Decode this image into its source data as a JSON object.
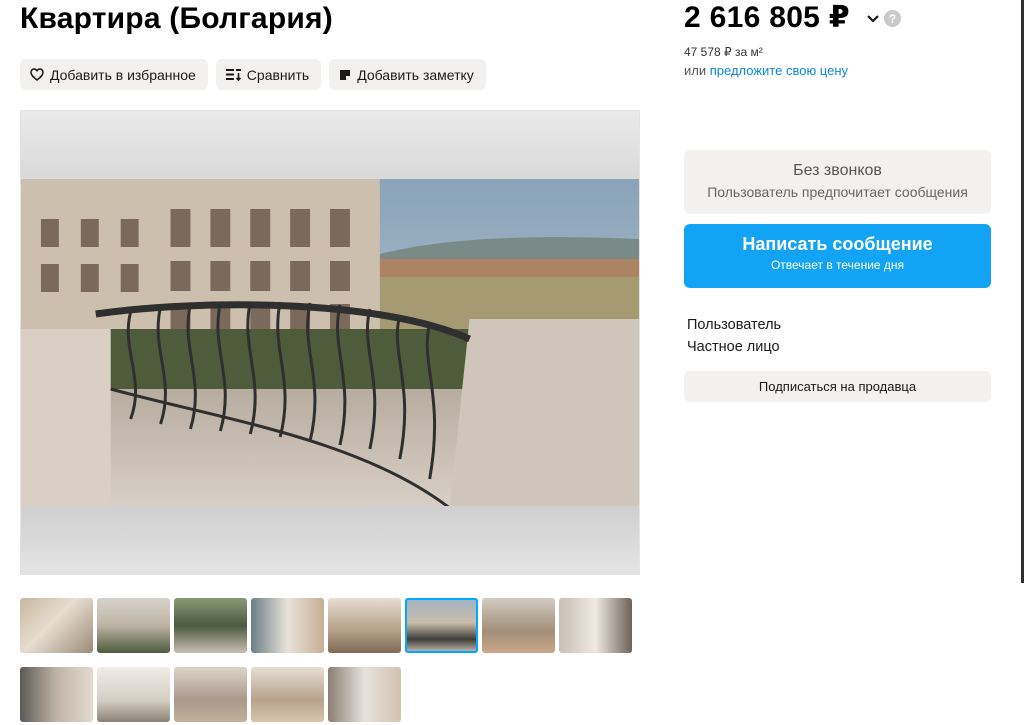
{
  "listing": {
    "title": "Квартира (Болгария)"
  },
  "actions": {
    "favorite_label": "Добавить в избранное",
    "compare_label": "Сравнить",
    "note_label": "Добавить заметку"
  },
  "price": {
    "value": "2 616 805 ₽",
    "per_m2": "47 578 ₽ за м²",
    "offer_prefix": "или",
    "offer_link": "предложите свою цену",
    "help_glyph": "?"
  },
  "contact": {
    "no_calls_title": "Без звонков",
    "no_calls_subtitle": "Пользователь предпочитает сообщения",
    "message_title": "Написать сообщение",
    "message_subtitle": "Отвечает в течение дня"
  },
  "seller": {
    "name": "Пользователь",
    "type": "Частное лицо",
    "subscribe_label": "Подписаться на продавца"
  },
  "gallery": {
    "thumbnails_count": 13,
    "active_thumbnail": 6
  },
  "icons": [
    "heart-icon",
    "compare-icon",
    "note-icon",
    "chevron-down-icon",
    "help-icon"
  ],
  "colors": {
    "accent_blue": "#13a3f4",
    "link_blue": "#0a88d8",
    "button_gray": "#f2f1f0",
    "active_outline": "#00aaff"
  }
}
